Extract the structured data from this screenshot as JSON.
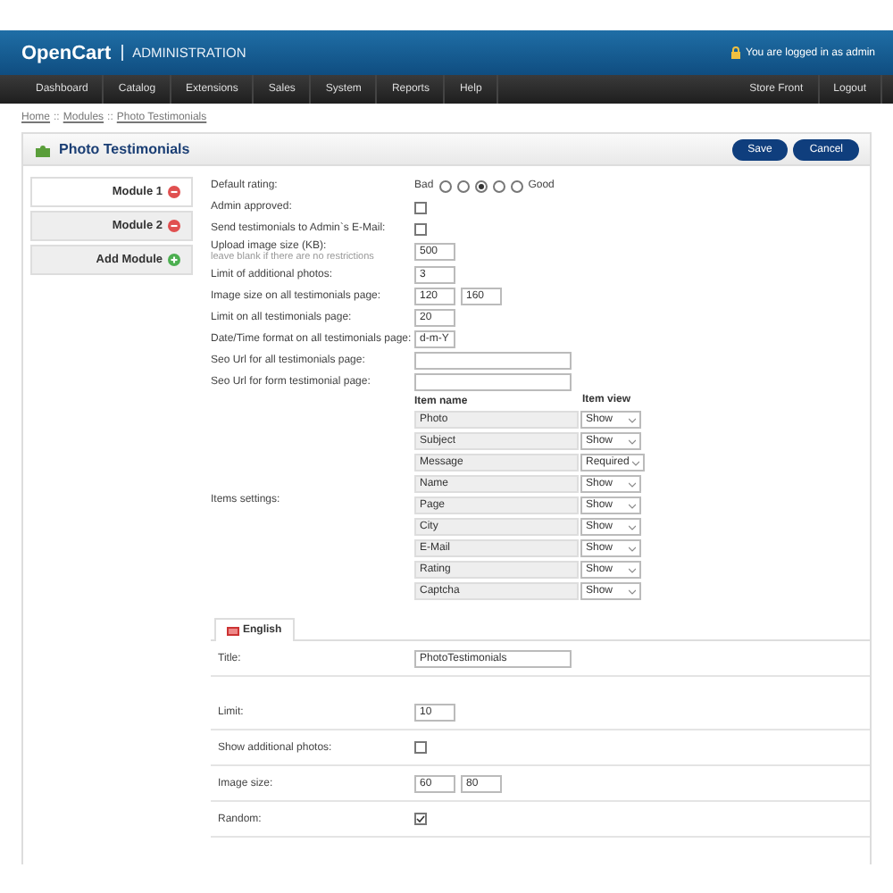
{
  "header": {
    "logo": "OpenCart",
    "subtitle": "ADMINISTRATION",
    "login_text": "You are logged in as admin"
  },
  "nav": {
    "left": [
      "Dashboard",
      "Catalog",
      "Extensions",
      "Sales",
      "System",
      "Reports",
      "Help"
    ],
    "right": [
      "Store Front",
      "Logout"
    ]
  },
  "breadcrumb": {
    "items": [
      "Home",
      "Modules",
      "Photo Testimonials"
    ],
    "separator": "::"
  },
  "heading": {
    "title": "Photo Testimonials",
    "buttons": [
      "Save",
      "Cancel"
    ]
  },
  "modules": [
    {
      "label": "Module 1",
      "kind": "remove",
      "selected": true
    },
    {
      "label": "Module 2",
      "kind": "remove",
      "selected": false
    },
    {
      "label": "Add Module",
      "kind": "add",
      "selected": false
    }
  ],
  "settings": [
    {
      "kind": "rating",
      "label": "Default rating:",
      "low": "Bad",
      "high": "Good",
      "options": [
        {
          "selected": false
        },
        {
          "selected": false
        },
        {
          "selected": true
        },
        {
          "selected": false
        },
        {
          "selected": false
        }
      ]
    },
    {
      "kind": "checkbox",
      "label": "Admin approved:",
      "checked": false
    },
    {
      "kind": "checkbox",
      "label": "Send testimonials to Admin`s E-Mail:",
      "checked": false
    },
    {
      "kind": "text",
      "label": "Upload image size (KB):",
      "hint": "leave blank if there are no restrictions",
      "values": [
        "500"
      ]
    },
    {
      "kind": "text",
      "label": "Limit of additional photos:",
      "values": [
        "3"
      ]
    },
    {
      "kind": "text",
      "label": "Image size on all testimonials page:",
      "values": [
        "120",
        "160"
      ]
    },
    {
      "kind": "text",
      "label": "Limit on all testimonials page:",
      "values": [
        "20"
      ]
    },
    {
      "kind": "text",
      "label": "Date/Time format on all testimonials page:",
      "values": [
        "d-m-Y"
      ]
    },
    {
      "kind": "blank",
      "label": "Seo Url for all testimonials page:"
    },
    {
      "kind": "blank",
      "label": "Seo Url for form testimonial page:"
    }
  ],
  "items": {
    "label": "Items settings:",
    "columns": [
      "Item name",
      "Item view"
    ],
    "rows": [
      {
        "name": "Photo",
        "view": "Show"
      },
      {
        "name": "Subject",
        "view": "Show"
      },
      {
        "name": "Message",
        "view": "Required"
      },
      {
        "name": "Name",
        "view": "Show"
      },
      {
        "name": "Page",
        "view": "Show"
      },
      {
        "name": "City",
        "view": "Show"
      },
      {
        "name": "E-Mail",
        "view": "Show"
      },
      {
        "name": "Rating",
        "view": "Show"
      },
      {
        "name": "Captcha",
        "view": "Show"
      }
    ]
  },
  "language_tabs": [
    {
      "label": "English",
      "selected": true
    }
  ],
  "language_fields": [
    {
      "kind": "wide",
      "label": "Title:",
      "values": [
        "PhotoTestimonials"
      ]
    },
    {
      "kind": "spacer"
    },
    {
      "kind": "text",
      "label": "Limit:",
      "values": [
        "10"
      ]
    },
    {
      "kind": "checkbox",
      "label": "Show additional photos:",
      "checked": false
    },
    {
      "kind": "text",
      "label": "Image size:",
      "values": [
        "60",
        "80"
      ]
    },
    {
      "kind": "checkbox",
      "label": "Random:",
      "checked": true
    }
  ]
}
